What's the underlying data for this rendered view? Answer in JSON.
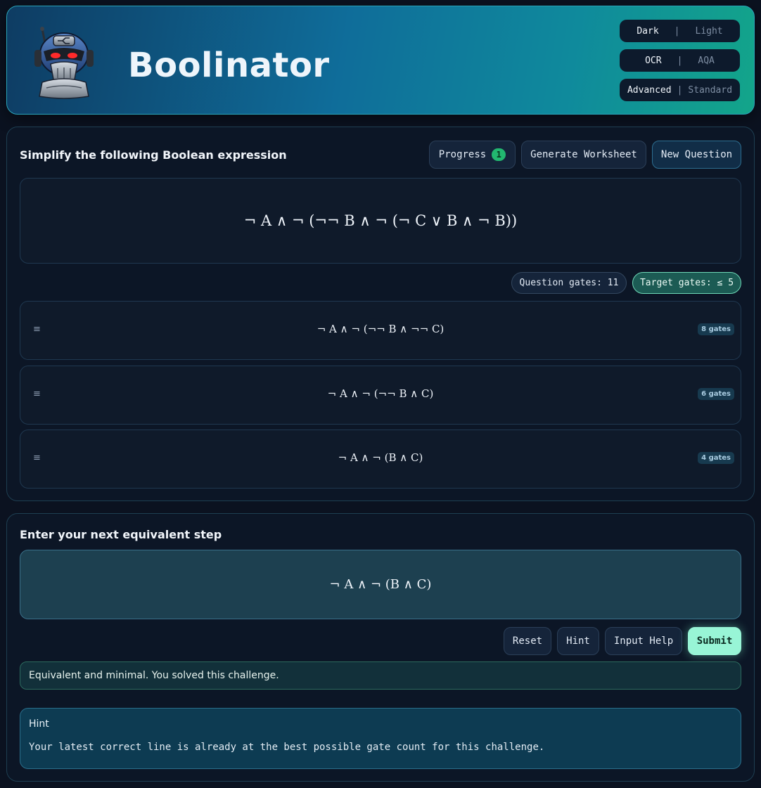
{
  "header": {
    "title": "Boolinator",
    "toggles": [
      {
        "on": "Dark",
        "off": "Light"
      },
      {
        "on": "OCR",
        "off": "AQA"
      },
      {
        "on": "Advanced",
        "off": "Standard"
      }
    ],
    "separator": "|"
  },
  "question": {
    "title": "Simplify the following Boolean expression",
    "progress_label": "Progress",
    "progress_count": "1",
    "worksheet_label": "Generate Worksheet",
    "new_question_label": "New Question",
    "expression": "¬ A ∧ ¬ (¬¬ B ∧ ¬ (¬ C ∨ B ∧ ¬ B))",
    "question_gates": "Question gates: 11",
    "target_gates": "Target gates: ≤ 5",
    "drag_glyph": "≡",
    "steps": [
      {
        "expr": "¬ A ∧ ¬ (¬¬ B ∧ ¬¬ C)",
        "gates": "8 gates"
      },
      {
        "expr": "¬ A ∧ ¬ (¬¬ B ∧ C)",
        "gates": "6 gates"
      },
      {
        "expr": "¬ A ∧ ¬ (B ∧ C)",
        "gates": "4 gates"
      }
    ]
  },
  "answer": {
    "title": "Enter your next equivalent step",
    "input_value": "¬ A ∧ ¬ (B ∧ C)",
    "reset_label": "Reset",
    "hint_label": "Hint",
    "input_help_label": "Input Help",
    "submit_label": "Submit",
    "feedback": "Equivalent and minimal. You solved this challenge.",
    "hint_title": "Hint",
    "hint_body": "Your latest correct line is already at the best possible gate count for this challenge."
  },
  "colors": {
    "accent": "#98f5d6",
    "success": "#22b870",
    "background": "#0b1220"
  }
}
